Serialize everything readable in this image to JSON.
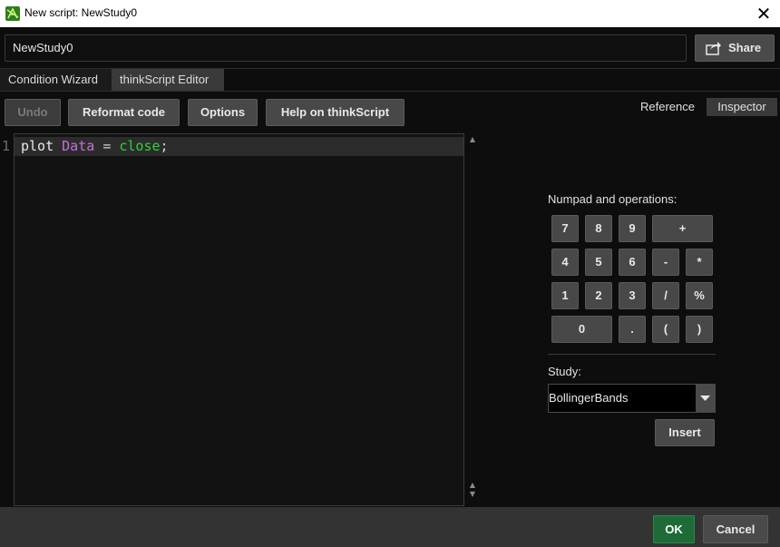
{
  "window": {
    "title": "New script: NewStudy0",
    "close_glyph": "✕",
    "icon": "thinkorswim-app-icon"
  },
  "name_row": {
    "script_name": "NewStudy0",
    "share_label": "Share"
  },
  "tabs": [
    {
      "label": "Condition Wizard",
      "active": false
    },
    {
      "label": "thinkScript Editor",
      "active": true
    }
  ],
  "toolbar": {
    "undo_label": "Undo",
    "reformat_label": "Reformat code",
    "options_label": "Options",
    "help_label": "Help on thinkScript"
  },
  "side_tabs": {
    "reference_label": "Reference",
    "inspector_label": "Inspector"
  },
  "editor": {
    "line_number": "1",
    "code": {
      "keyword": "plot",
      "variable": "Data",
      "operator": "=",
      "function": "close",
      "terminator": ";"
    },
    "colors": {
      "keyword": "#e8e8e8",
      "variable": "#c470d8",
      "function": "#2fd03a"
    }
  },
  "numpad": {
    "title": "Numpad and operations:",
    "rows": [
      [
        "7",
        "8",
        "9",
        "+"
      ],
      [
        "4",
        "5",
        "6",
        "-",
        "*"
      ],
      [
        "1",
        "2",
        "3",
        "/",
        "%"
      ],
      [
        "0",
        ".",
        "(",
        ")"
      ]
    ]
  },
  "study": {
    "label": "Study:",
    "selected": "BollingerBands",
    "insert_label": "Insert"
  },
  "footer": {
    "ok_label": "OK",
    "cancel_label": "Cancel",
    "ok_color": "#1e6b37"
  }
}
